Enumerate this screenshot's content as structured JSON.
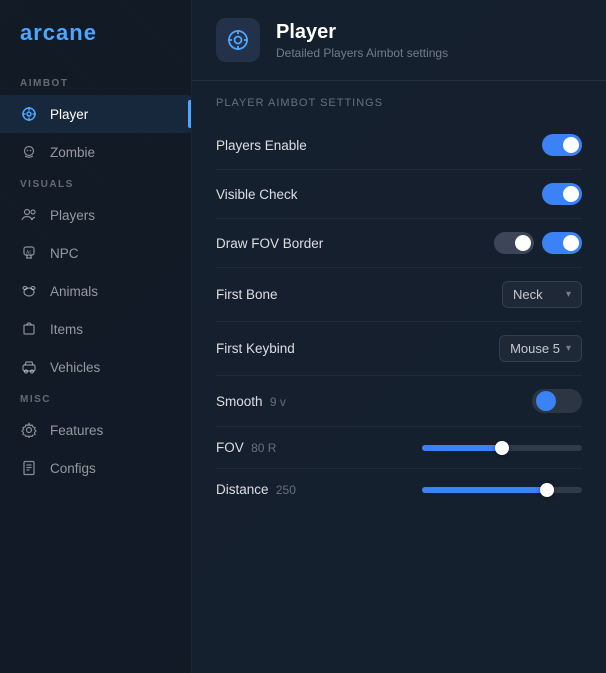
{
  "app": {
    "logo": "arcane"
  },
  "sidebar": {
    "sections": [
      {
        "label": "AIMBOT",
        "items": [
          {
            "id": "player",
            "label": "Player",
            "active": true,
            "icon": "crosshair"
          },
          {
            "id": "zombie",
            "label": "Zombie",
            "active": false,
            "icon": "zombie"
          }
        ]
      },
      {
        "label": "VISUALS",
        "items": [
          {
            "id": "players",
            "label": "Players",
            "active": false,
            "icon": "users"
          },
          {
            "id": "npc",
            "label": "NPC",
            "active": false,
            "icon": "ai"
          },
          {
            "id": "animals",
            "label": "Animals",
            "active": false,
            "icon": "animals"
          },
          {
            "id": "items",
            "label": "Items",
            "active": false,
            "icon": "items"
          },
          {
            "id": "vehicles",
            "label": "Vehicles",
            "active": false,
            "icon": "vehicles"
          }
        ]
      },
      {
        "label": "MISC",
        "items": [
          {
            "id": "features",
            "label": "Features",
            "active": false,
            "icon": "gear"
          },
          {
            "id": "configs",
            "label": "Configs",
            "active": false,
            "icon": "file"
          }
        ]
      }
    ]
  },
  "header": {
    "title": "Player",
    "subtitle": "Detailed Players Aimbot settings",
    "icon": "⊕"
  },
  "settings": {
    "section_label": "Player Aimbot Settings",
    "rows": [
      {
        "id": "players_enable",
        "label": "Players Enable",
        "type": "toggle",
        "value": true
      },
      {
        "id": "visible_check",
        "label": "Visible Check",
        "type": "toggle",
        "value": true
      },
      {
        "id": "draw_fov_border",
        "label": "Draw FOV Border",
        "type": "dual_toggle",
        "value": true,
        "secondary": true
      },
      {
        "id": "first_bone",
        "label": "First Bone",
        "type": "dropdown",
        "value": "Neck"
      },
      {
        "id": "first_keybind",
        "label": "First Keybind",
        "type": "dropdown",
        "value": "Mouse 5"
      },
      {
        "id": "smooth",
        "label": "Smooth",
        "sub_label": "9",
        "sub_suffix": "v",
        "type": "smooth_toggle",
        "value": true
      },
      {
        "id": "fov",
        "label": "FOV",
        "sub_label": "80",
        "sub_suffix": "R",
        "type": "slider",
        "percent": 50,
        "fill_percent": 50
      },
      {
        "id": "distance",
        "label": "Distance",
        "sub_label": "250",
        "sub_suffix": "",
        "type": "slider",
        "percent": 78,
        "fill_percent": 78
      }
    ]
  },
  "icons": {
    "crosshair": "◎",
    "zombie": "☻",
    "users": "👥",
    "ai": "🤖",
    "animals": "🐾",
    "items": "🧳",
    "vehicles": "🚗",
    "gear": "⚙",
    "file": "📄",
    "chevron_down": "▾"
  }
}
